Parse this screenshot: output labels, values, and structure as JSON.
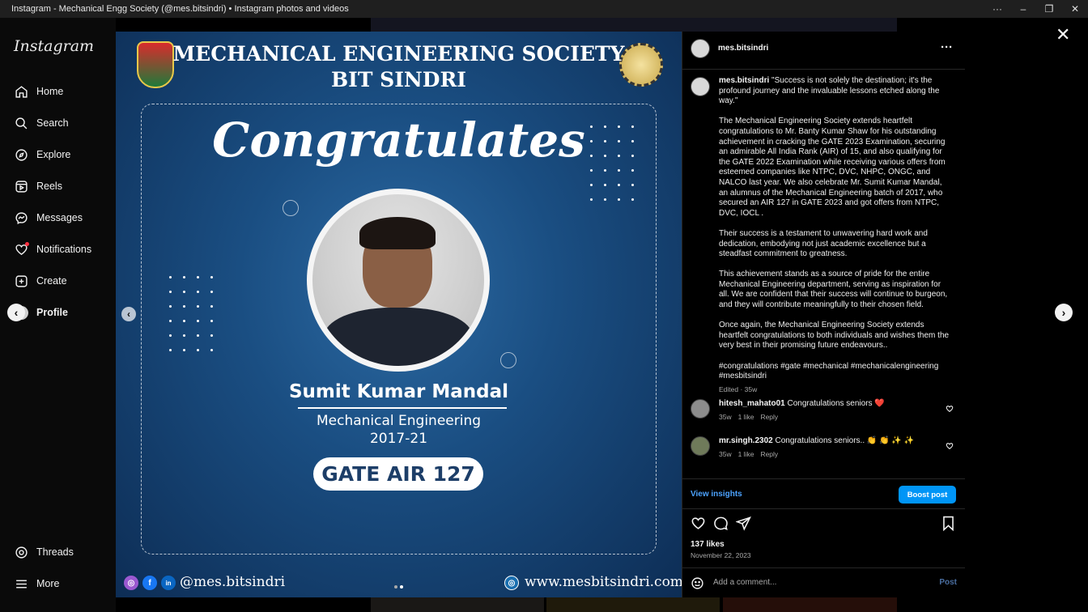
{
  "window": {
    "title": "Instagram - Mechanical Engg Society (@mes.bitsindri) • Instagram photos and videos"
  },
  "sidebar": {
    "logo": "Instagram",
    "items": [
      {
        "label": "Home",
        "icon": "home-icon"
      },
      {
        "label": "Search",
        "icon": "search-icon"
      },
      {
        "label": "Explore",
        "icon": "compass-icon"
      },
      {
        "label": "Reels",
        "icon": "reels-icon"
      },
      {
        "label": "Messages",
        "icon": "messenger-icon"
      },
      {
        "label": "Notifications",
        "icon": "heart-icon"
      },
      {
        "label": "Create",
        "icon": "plus-square-icon"
      },
      {
        "label": "Profile",
        "icon": "avatar-icon"
      }
    ],
    "bottom": [
      {
        "label": "Threads",
        "icon": "threads-icon"
      },
      {
        "label": "More",
        "icon": "menu-icon"
      }
    ]
  },
  "post_image": {
    "society_line1": "MECHANICAL ENGINEERING SOCIETY",
    "society_line2": "BIT SINDRI",
    "headline": "Congratulates",
    "person_name": "Sumit Kumar Mandal",
    "department": "Mechanical Engineering",
    "batch": "2017-21",
    "achievement": "GATE AIR 127",
    "handle": "@mes.bitsindri",
    "website": "www.mesbitsindri.com"
  },
  "post": {
    "author": "mes.bitsindri",
    "caption_paragraphs": [
      "\"Success is not solely the destination; it's the profound journey and the invaluable lessons etched along the way.\"",
      "The Mechanical Engineering Society extends heartfelt congratulations to Mr. Banty Kumar Shaw for his outstanding achievement in cracking the GATE 2023 Examination, securing an admirable All India Rank (AIR) of 15, and also qualifying for the GATE 2022 Examination while receiving various offers from esteemed companies like NTPC, DVC, NHPC, ONGC, and NALCO last year. We also celebrate Mr. Sumit Kumar Mandal, an alumnus of the Mechanical Engineering batch of 2017, who secured an AIR 127 in GATE 2023 and got offers from NTPC, DVC, IOCL .",
      "Their success is a testament to unwavering hard work and dedication, embodying not just academic excellence but a steadfast commitment to greatness.",
      "This achievement stands as a source of pride for the entire Mechanical Engineering department, serving as inspiration for all. We are confident that their success will continue to burgeon, and they will contribute meaningfully to their chosen field.",
      "Once again, the Mechanical Engineering Society extends heartfelt congratulations to both individuals and wishes them the very best in their promising future endeavours..",
      "#congratulations #gate #mechanical #mechanicalengineering #mesbitsindri"
    ],
    "edited_meta": "Edited · 35w",
    "comments": [
      {
        "user": "hitesh_mahato01",
        "text": "Congratulations seniors ❤️",
        "age": "35w",
        "likes": "1 like",
        "reply": "Reply"
      },
      {
        "user": "mr.singh.2302",
        "text": "Congratulations seniors.. 👏 👏 ✨ ✨",
        "age": "35w",
        "likes": "1 like",
        "reply": "Reply"
      }
    ],
    "view_insights": "View insights",
    "boost_label": "Boost post",
    "likes": "137 likes",
    "date": "November 22, 2023",
    "comment_placeholder": "Add a comment...",
    "post_label": "Post"
  },
  "colors": {
    "accent": "#0095f6",
    "link": "#4ca3ff"
  }
}
